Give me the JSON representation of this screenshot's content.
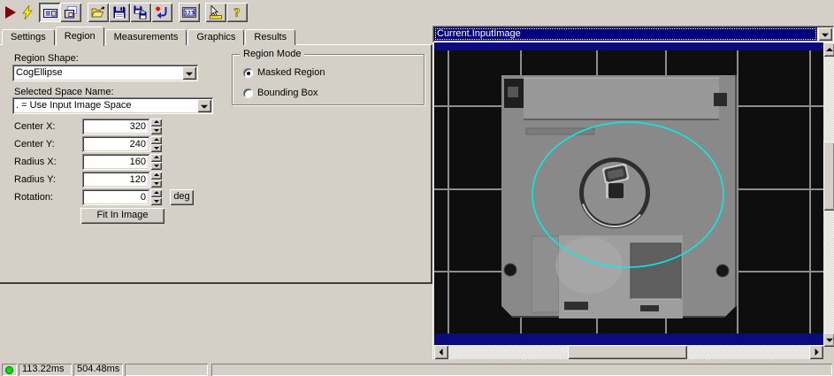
{
  "toolbar": {
    "numbers_label": "123",
    "help_label": "?",
    "buttons": [
      {
        "name": "run",
        "icon": "run-icon"
      },
      {
        "name": "electric-run",
        "icon": "lightning-icon"
      },
      {
        "name": "show-image-display",
        "icon": "image-display-icon",
        "pressed": true
      },
      {
        "name": "float-image-display",
        "icon": "float-display-icon",
        "pressed": false
      },
      {
        "name": "open-file",
        "icon": "open-folder-icon"
      },
      {
        "name": "save",
        "icon": "save-floppy-icon"
      },
      {
        "name": "save-image",
        "icon": "save-image-icon"
      },
      {
        "name": "reset",
        "icon": "reset-arrow-icon"
      },
      {
        "name": "show-values",
        "icon": "numbers-icon"
      },
      {
        "name": "position-tool",
        "icon": "pointer-ruler-icon"
      },
      {
        "name": "help",
        "icon": "help-icon"
      }
    ]
  },
  "tabs": [
    {
      "label": "Settings",
      "active": false
    },
    {
      "label": "Region",
      "active": true
    },
    {
      "label": "Measurements",
      "active": false
    },
    {
      "label": "Graphics",
      "active": false
    },
    {
      "label": "Results",
      "active": false
    }
  ],
  "region_page": {
    "region_shape_label": "Region Shape:",
    "region_shape_value": "CogEllipse",
    "space_name_label": "Selected Space Name:",
    "space_name_value": ". = Use Input Image Space",
    "fields": [
      {
        "label": "Center X:",
        "value": "320"
      },
      {
        "label": "Center Y:",
        "value": "240"
      },
      {
        "label": "Radius X:",
        "value": "160"
      },
      {
        "label": "Radius Y:",
        "value": "120"
      },
      {
        "label": "Rotation:",
        "value": "0",
        "unit": "deg"
      }
    ],
    "deg_button_label": "deg",
    "fit_button_label": "Fit In Image",
    "region_mode": {
      "title": "Region Mode",
      "options": [
        {
          "label": "Masked Region",
          "selected": true
        },
        {
          "label": "Bounding Box",
          "selected": false
        }
      ]
    }
  },
  "display": {
    "image_selector_value": "Current.InputImage",
    "overlay_color": "#00F0F0",
    "subject": "floppy disk on dark calibration grid"
  },
  "status_bar": {
    "indicator_color": "#00E000",
    "panels": [
      "113.22ms",
      "504.48ms",
      "",
      ""
    ]
  },
  "colors": {
    "window_bg": "#D4D0C8",
    "selection_navy": "#000080"
  }
}
